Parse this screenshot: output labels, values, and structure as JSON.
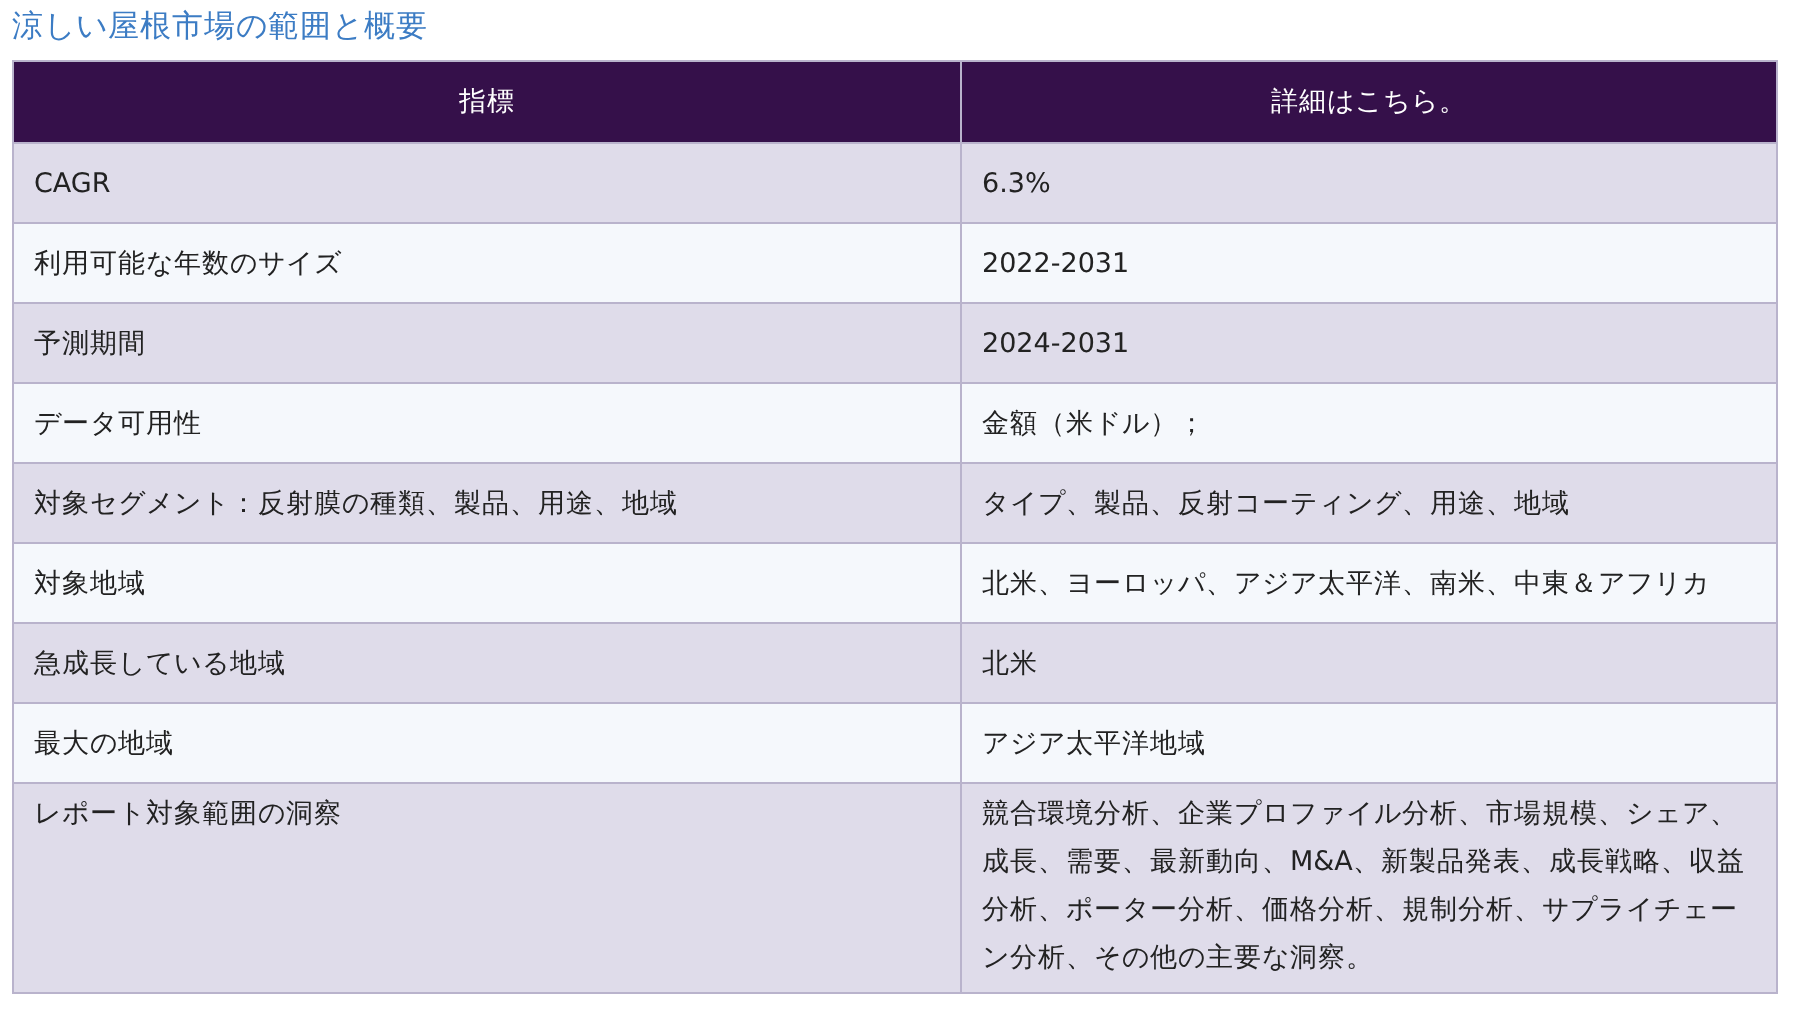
{
  "title": "涼しい屋根市場の範囲と概要",
  "table": {
    "columns": [
      "指標",
      "詳細はこちら。"
    ],
    "rows": [
      [
        "CAGR",
        "6.3%"
      ],
      [
        "利用可能な年数のサイズ",
        "2022-2031"
      ],
      [
        "予測期間",
        "2024-2031"
      ],
      [
        "データ可用性",
        "金額（米ドル）；"
      ],
      [
        "対象セグメント：反射膜の種類、製品、用途、地域",
        "タイプ、製品、反射コーティング、用途、地域"
      ],
      [
        "対象地域",
        "北米、ヨーロッパ、アジア太平洋、南米、中東＆アフリカ"
      ],
      [
        "急成長している地域",
        "北米"
      ],
      [
        "最大の地域",
        "アジア太平洋地域"
      ],
      [
        "レポート対象範囲の洞察",
        "競合環境分析、企業プロファイル分析、市場規模、シェア、成長、需要、最新動向、M&A、新製品発表、成長戦略、収益分析、ポーター分析、価格分析、規制分析、サプライチェーン分析、その他の主要な洞察。"
      ]
    ]
  }
}
